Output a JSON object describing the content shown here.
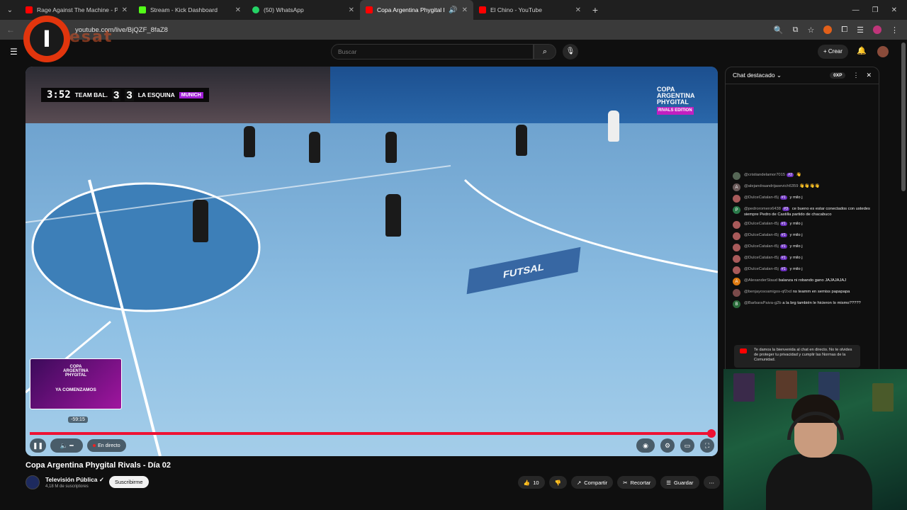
{
  "tabs": [
    {
      "title": "Rage Against The Machine - Pe",
      "color": "#ff0000",
      "active": false
    },
    {
      "title": "Stream - Kick Dashboard",
      "color": "#53fc18",
      "active": false
    },
    {
      "title": "(50) WhatsApp",
      "color": "#25d366",
      "active": false
    },
    {
      "title": "Copa Argentina Phygital Ri",
      "color": "#ff0000",
      "active": true
    },
    {
      "title": "El Chino - YouTube",
      "color": "#ff0000",
      "active": false
    }
  ],
  "address": {
    "url": "youtube.com/live/BjQZF_8faZ8"
  },
  "logo": {
    "letter": "I",
    "text": "esat"
  },
  "header": {
    "search_placeholder": "Buscar",
    "create_label": "Crear"
  },
  "scoreboard": {
    "time": "3:52",
    "team_home": "TEAM BAL.",
    "score_home": "3",
    "score_away": "3",
    "team_away": "LA ESQUINA",
    "sponsor": "MUNICH"
  },
  "event_logo": {
    "line1": "COPA",
    "line2": "ARGENTINA",
    "line3": "PHYGITAL",
    "sub": "RIVALS EDITION"
  },
  "court": {
    "mat_text": "FUTSAL"
  },
  "preview": {
    "l1": "COPA",
    "l2": "ARGENTINA",
    "l3": "PHYGITAL",
    "cta": "YA COMENZAMOS"
  },
  "player": {
    "hover_time": "-59:15",
    "live_label": "En directo"
  },
  "video": {
    "title": "Copa Argentina Phygital Rivals - Día 02",
    "channel": "Televisión Pública",
    "subscribers": "4,18 M de suscriptores",
    "subscribe_label": "Suscribirme",
    "likes": "10",
    "share_label": "Compartir",
    "clip_label": "Recortar",
    "save_label": "Guardar"
  },
  "chat": {
    "header_title": "Chat destacado",
    "xp": "0XP",
    "messages": [
      {
        "user": "@cristiandelamor7015",
        "badge": "#2",
        "text": "👋",
        "av_color": "#556655",
        "av_letter": ""
      },
      {
        "user": "@alejandraandrijasevich6359",
        "badge": "",
        "text": "👋👋👋👋",
        "av_color": "#6a5a5a",
        "av_letter": "A"
      },
      {
        "user": "@DulceCatalan-t5j",
        "badge": "#1",
        "text": "y milo j",
        "av_color": "#a85a5a",
        "av_letter": ""
      },
      {
        "user": "@pedroromero6438",
        "badge": "#3",
        "text": "ce bueno es estar conectados con ustedes siempre Pedro de Castilla partido de chacabuco",
        "av_color": "#2a7a4a",
        "av_letter": "P"
      },
      {
        "user": "@DulceCatalan-t5j",
        "badge": "#1",
        "text": "y milo j",
        "av_color": "#a85a5a",
        "av_letter": ""
      },
      {
        "user": "@DulceCatalan-t5j",
        "badge": "#1",
        "text": "y milo j",
        "av_color": "#a85a5a",
        "av_letter": ""
      },
      {
        "user": "@DulceCatalan-t5j",
        "badge": "#1",
        "text": "y milo j",
        "av_color": "#a85a5a",
        "av_letter": ""
      },
      {
        "user": "@DulceCatalan-t5j",
        "badge": "#1",
        "text": "y milo j",
        "av_color": "#a85a5a",
        "av_letter": ""
      },
      {
        "user": "@DulceCatalan-t5j",
        "badge": "#1",
        "text": "y milo j",
        "av_color": "#a85a5a",
        "av_letter": ""
      },
      {
        "user": "@AlexanderStaud",
        "badge": "",
        "text": "balanza ni robando gano JAJAJAJAJ",
        "av_color": "#e07a10",
        "av_letter": "A"
      },
      {
        "user": "@benjayosoamigos-qf2xd",
        "badge": "",
        "text": "ns teamm en semiss papapapa",
        "av_color": "#7a4a4a",
        "av_letter": ""
      },
      {
        "user": "@BarbaraPaiva-g2b",
        "badge": "",
        "text": "a la brg también le hicieron lo mismo?????",
        "av_color": "#2a6a3a",
        "av_letter": "B"
      }
    ],
    "notice": "Te damos la bienvenida al chat en directo. No te olvides de proteger tu privacidad y cumplir las Normas de la Comunidad."
  }
}
